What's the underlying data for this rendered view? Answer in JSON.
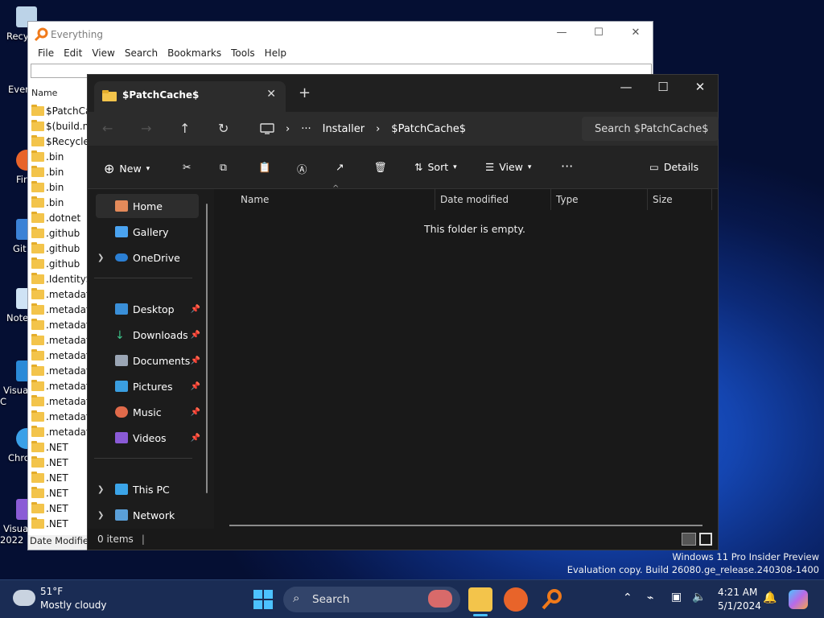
{
  "desktop": {
    "icons": [
      "Recy",
      "Ever",
      "Fir",
      "Git",
      "Note",
      "Visua C",
      "Chro",
      "Visua 2022"
    ],
    "watermark_line1": "Windows 11 Pro Insider Preview",
    "watermark_line2": "Evaluation copy. Build 26080.ge_release.240308-1400"
  },
  "everything": {
    "title": "Everything",
    "menu": [
      "File",
      "Edit",
      "View",
      "Search",
      "Bookmarks",
      "Tools",
      "Help"
    ],
    "col_name": "Name",
    "rows": [
      "$PatchCa",
      "$(build.nt",
      "$Recycle.B",
      ".bin",
      ".bin",
      ".bin",
      ".bin",
      ".dotnet",
      ".github",
      ".github",
      ".github",
      ".IdentitySe",
      ".metadata",
      ".metadata",
      ".metadata",
      ".metadata",
      ".metadata",
      ".metadata",
      ".metadata",
      ".metadata",
      ".metadata",
      ".metadata",
      ".NET",
      ".NET",
      ".NET",
      ".NET",
      ".NET",
      ".NET"
    ],
    "status": "Date Modified:"
  },
  "explorer": {
    "tab_title": "$PatchCache$",
    "path_ellipsis": "···",
    "path": [
      "Installer",
      "$PatchCache$"
    ],
    "search_placeholder": "Search $PatchCache$",
    "cmd": {
      "new": "New",
      "sort": "Sort",
      "view": "View",
      "more": "···",
      "details": "Details"
    },
    "nav": {
      "home": "Home",
      "gallery": "Gallery",
      "onedrive": "OneDrive",
      "desktop": "Desktop",
      "downloads": "Downloads",
      "documents": "Documents",
      "pictures": "Pictures",
      "music": "Music",
      "videos": "Videos",
      "thispc": "This PC",
      "network": "Network"
    },
    "columns": [
      "Name",
      "Date modified",
      "Type",
      "Size"
    ],
    "empty": "This folder is empty.",
    "items": "0 items"
  },
  "taskbar": {
    "weather_temp": "51°F",
    "weather_desc": "Mostly cloudy",
    "search": "Search",
    "time": "4:21 AM",
    "date": "5/1/2024"
  },
  "colors": {
    "explorer_bg": "#191919",
    "accent": "#4aa3f0",
    "folder": "#f3c44b"
  }
}
